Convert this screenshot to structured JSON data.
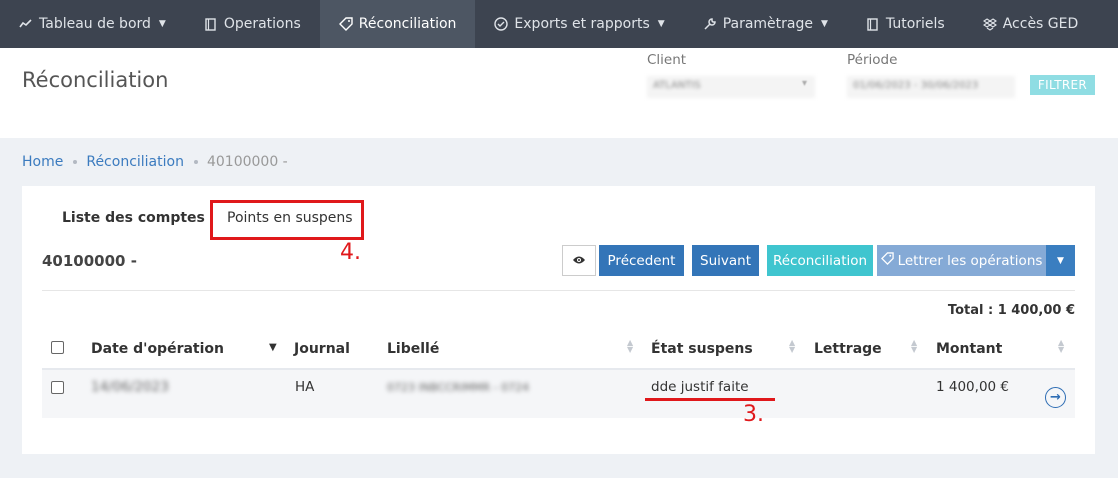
{
  "nav": {
    "items": [
      {
        "label": "Tableau de bord",
        "icon": "chart-line-icon",
        "caret": true
      },
      {
        "label": "Operations",
        "icon": "book-icon",
        "caret": false
      },
      {
        "label": "Réconciliation",
        "icon": "tag-icon",
        "caret": false,
        "active": true
      },
      {
        "label": "Exports et rapports",
        "icon": "check-circle-icon",
        "caret": true
      },
      {
        "label": "Paramètrage",
        "icon": "wrench-icon",
        "caret": true
      },
      {
        "label": "Tutoriels",
        "icon": "book-icon",
        "caret": false
      },
      {
        "label": "Accès GED",
        "icon": "dropbox-icon",
        "caret": false
      }
    ]
  },
  "header": {
    "title": "Réconciliation",
    "client_label": "Client",
    "client_value": "ATLANTIS",
    "periode_label": "Période",
    "periode_value": "01/06/2023 - 30/06/2023",
    "filter_button": "FILTRER"
  },
  "breadcrumb": {
    "home": "Home",
    "reconciliation": "Réconciliation",
    "current": "40100000 -"
  },
  "tabs": {
    "liste": "Liste des comptes",
    "points": "Points en suspens"
  },
  "annotations": {
    "four": "4.",
    "three": "3."
  },
  "account": {
    "title": "40100000 -"
  },
  "toolbar": {
    "precedent": "Précedent",
    "suivant": "Suivant",
    "reconciliation": "Réconciliation",
    "lettrer": "Lettrer les opérations"
  },
  "total": "Total : 1 400,00 €",
  "table": {
    "headers": {
      "date": "Date d'opération",
      "journal": "Journal",
      "libelle": "Libellé",
      "etat": "État suspens",
      "lettrage": "Lettrage",
      "montant": "Montant"
    },
    "rows": [
      {
        "date": "14/06/2023",
        "journal": "HA",
        "libelle": "0723 INBCCRIMMR - 0724",
        "etat": "dde justif faite",
        "lettrage": "",
        "montant": "1 400,00 €"
      }
    ]
  },
  "colors": {
    "nav_bg": "#3d4450",
    "nav_active": "#4d5663",
    "primary": "#3375b8",
    "info": "#3fc5cf",
    "lettrer": "#85aad6",
    "annotation_red": "#e0181b"
  }
}
